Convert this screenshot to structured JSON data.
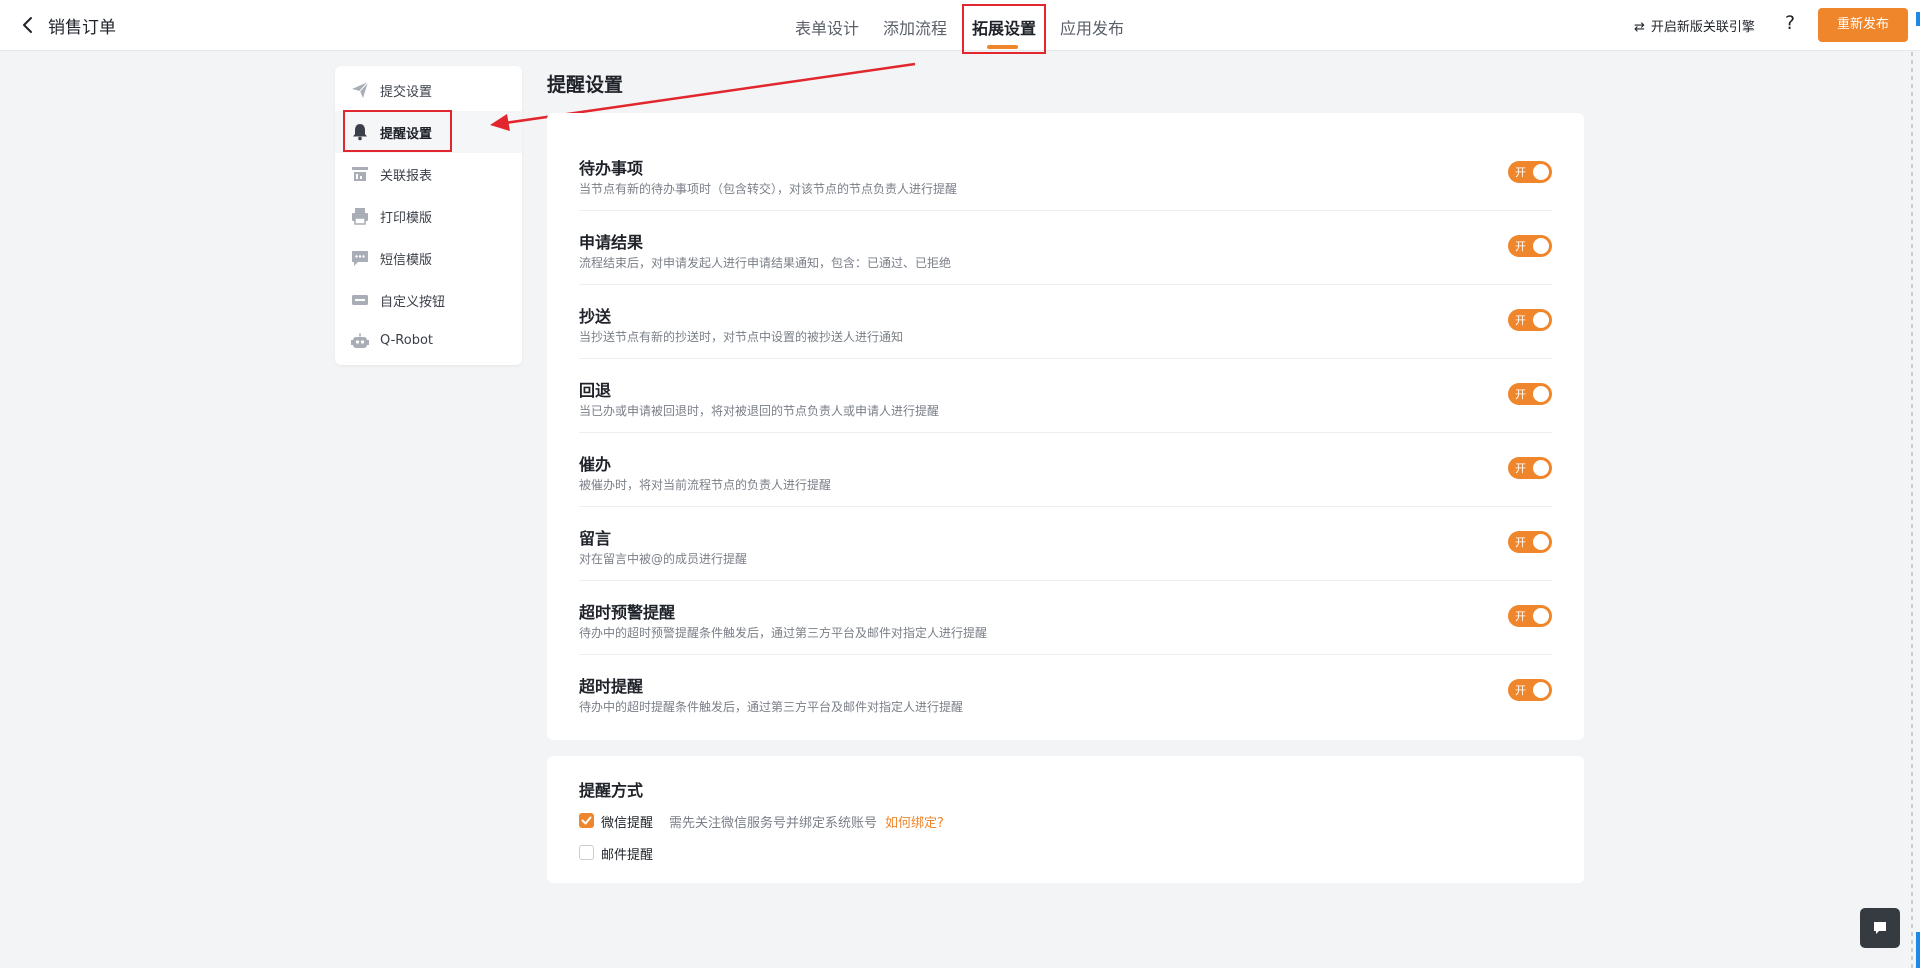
{
  "header": {
    "title": "销售订单",
    "tabs": [
      {
        "label": "表单设计"
      },
      {
        "label": "添加流程"
      },
      {
        "label": "拓展设置",
        "active": true
      },
      {
        "label": "应用发布"
      }
    ],
    "engine_link": "开启新版关联引擎",
    "help": "?",
    "publish_button": "重新发布"
  },
  "sidebar": {
    "items": [
      {
        "label": "提交设置",
        "icon": "send-icon"
      },
      {
        "label": "提醒设置",
        "icon": "bell-icon",
        "active": true
      },
      {
        "label": "关联报表",
        "icon": "report-icon"
      },
      {
        "label": "打印模版",
        "icon": "printer-icon"
      },
      {
        "label": "短信模版",
        "icon": "sms-icon"
      },
      {
        "label": "自定义按钮",
        "icon": "button-icon"
      },
      {
        "label": "Q-Robot",
        "icon": "robot-icon"
      }
    ]
  },
  "main": {
    "title": "提醒设置",
    "settings": [
      {
        "title": "待办事项",
        "desc": "当节点有新的待办事项时（包含转交），对该节点的节点负责人进行提醒",
        "toggle": "开",
        "on": true
      },
      {
        "title": "申请结果",
        "desc": "流程结束后，对申请发起人进行申请结果通知，包含：已通过、已拒绝",
        "toggle": "开",
        "on": true
      },
      {
        "title": "抄送",
        "desc": "当抄送节点有新的抄送时，对节点中设置的被抄送人进行通知",
        "toggle": "开",
        "on": true
      },
      {
        "title": "回退",
        "desc": "当已办或申请被回退时，将对被退回的节点负责人或申请人进行提醒",
        "toggle": "开",
        "on": true
      },
      {
        "title": "催办",
        "desc": "被催办时，将对当前流程节点的负责人进行提醒",
        "toggle": "开",
        "on": true
      },
      {
        "title": "留言",
        "desc": "对在留言中被@的成员进行提醒",
        "toggle": "开",
        "on": true
      },
      {
        "title": "超时预警提醒",
        "desc": "待办中的超时预警提醒条件触发后，通过第三方平台及邮件对指定人进行提醒",
        "toggle": "开",
        "on": true
      },
      {
        "title": "超时提醒",
        "desc": "待办中的超时提醒条件触发后，通过第三方平台及邮件对指定人进行提醒",
        "toggle": "开",
        "on": true
      }
    ],
    "method": {
      "title": "提醒方式",
      "wechat": {
        "label": "微信提醒",
        "hint": "需先关注微信服务号并绑定系统账号",
        "link": "如何绑定?",
        "checked": true
      },
      "email": {
        "label": "邮件提醒",
        "checked": false
      }
    }
  },
  "colors": {
    "accent": "#f0862c",
    "annotation": "#e1262d"
  }
}
